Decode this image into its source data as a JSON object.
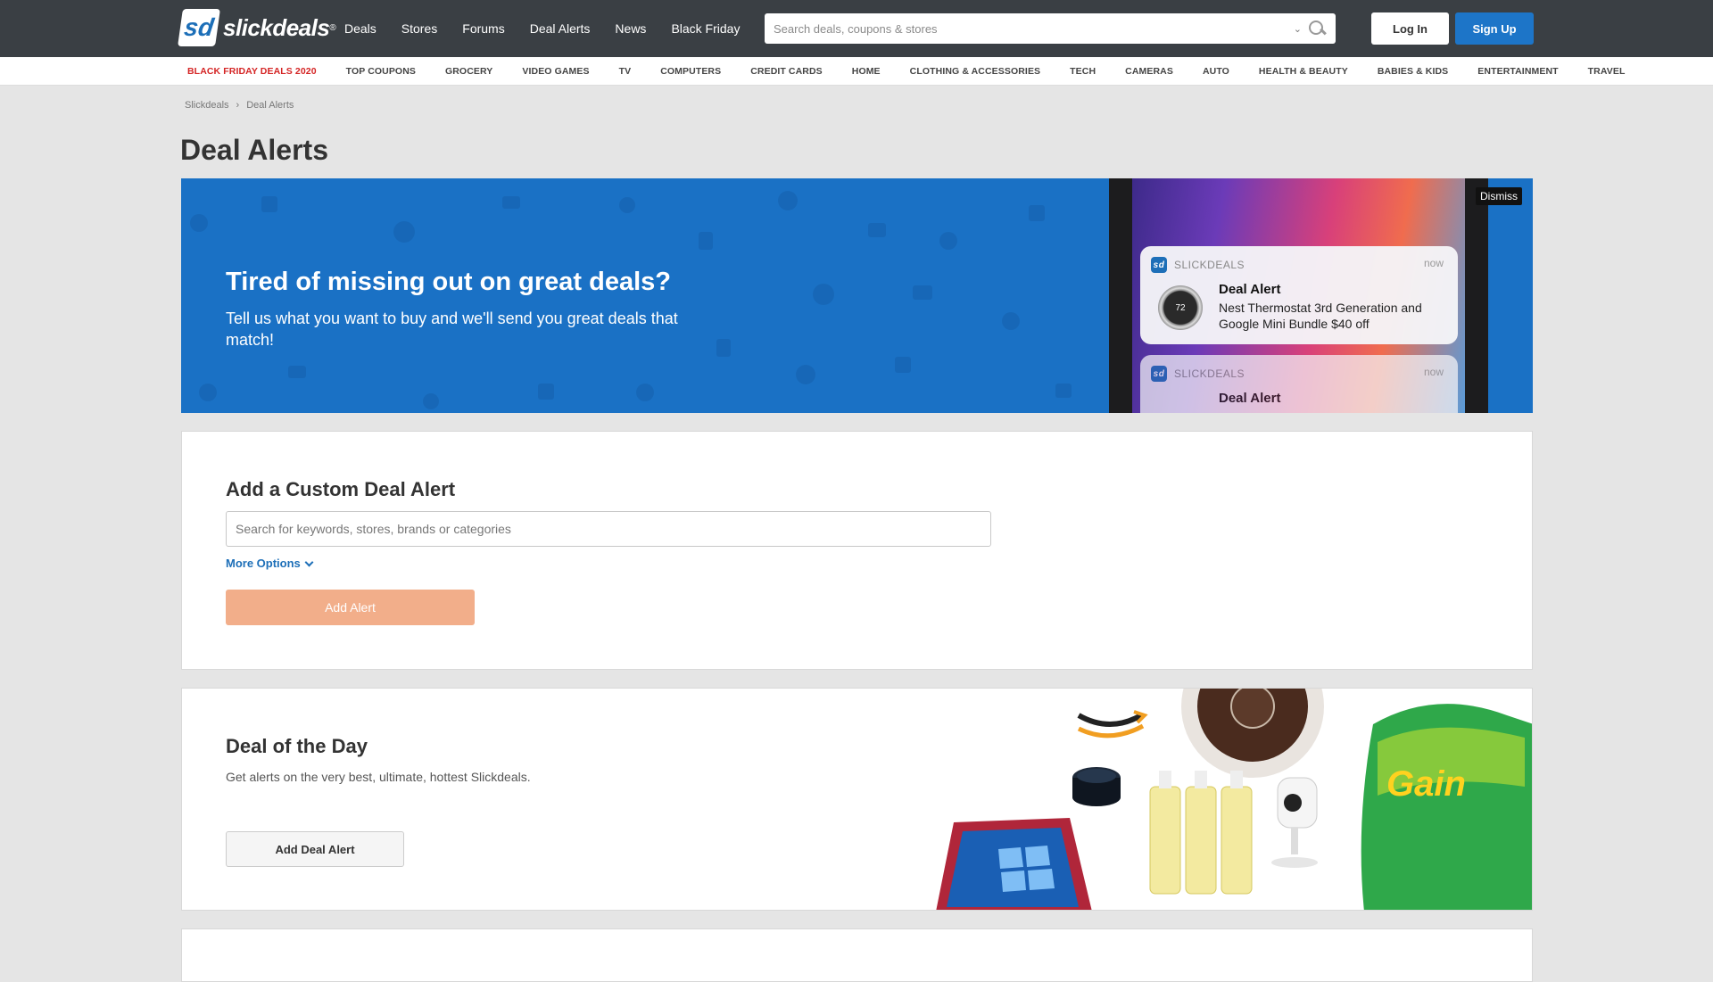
{
  "header": {
    "logo_mark": "sd",
    "logo_text": "slickdeals",
    "logo_reg": "®",
    "nav": [
      "Deals",
      "Stores",
      "Forums",
      "Deal Alerts",
      "News",
      "Black Friday"
    ],
    "search_placeholder": "Search deals, coupons & stores",
    "login_label": "Log In",
    "signup_label": "Sign Up"
  },
  "categories": [
    "Black Friday Deals 2020",
    "Top Coupons",
    "Grocery",
    "Video Games",
    "TV",
    "Computers",
    "Credit Cards",
    "Home",
    "Clothing & Accessories",
    "Tech",
    "Cameras",
    "Auto",
    "Health & Beauty",
    "Babies & Kids",
    "Entertainment",
    "Travel"
  ],
  "breadcrumb": [
    "Slickdeals",
    "Deal Alerts"
  ],
  "page_title": "Deal Alerts",
  "banner": {
    "headline": "Tired of missing out on great deals?",
    "subtext": "Tell us what you want to buy and we'll send you great deals that match!",
    "dismiss_label": "Dismiss",
    "notification1": {
      "app": "SLICKDEALS",
      "time": "now",
      "title": "Deal Alert",
      "body": "Nest Thermostat 3rd Generation and Google Mini Bundle $40 off",
      "thermostat_value": "72"
    },
    "notification2": {
      "app": "SLICKDEALS",
      "time": "now",
      "title": "Deal Alert"
    }
  },
  "custom_alert": {
    "title": "Add a Custom Deal Alert",
    "input_placeholder": "Search for keywords, stores, brands or categories",
    "more_options": "More Options",
    "add_button": "Add Alert"
  },
  "deal_of_day": {
    "title": "Deal of the Day",
    "description": "Get alerts on the very best, ultimate, hottest Slickdeals.",
    "add_button": "Add Deal Alert"
  },
  "colors": {
    "header_bg": "#3a3f44",
    "brand_blue": "#1d75c8",
    "hot_red": "#d42424",
    "add_alert_bg": "#f2ae8a"
  }
}
